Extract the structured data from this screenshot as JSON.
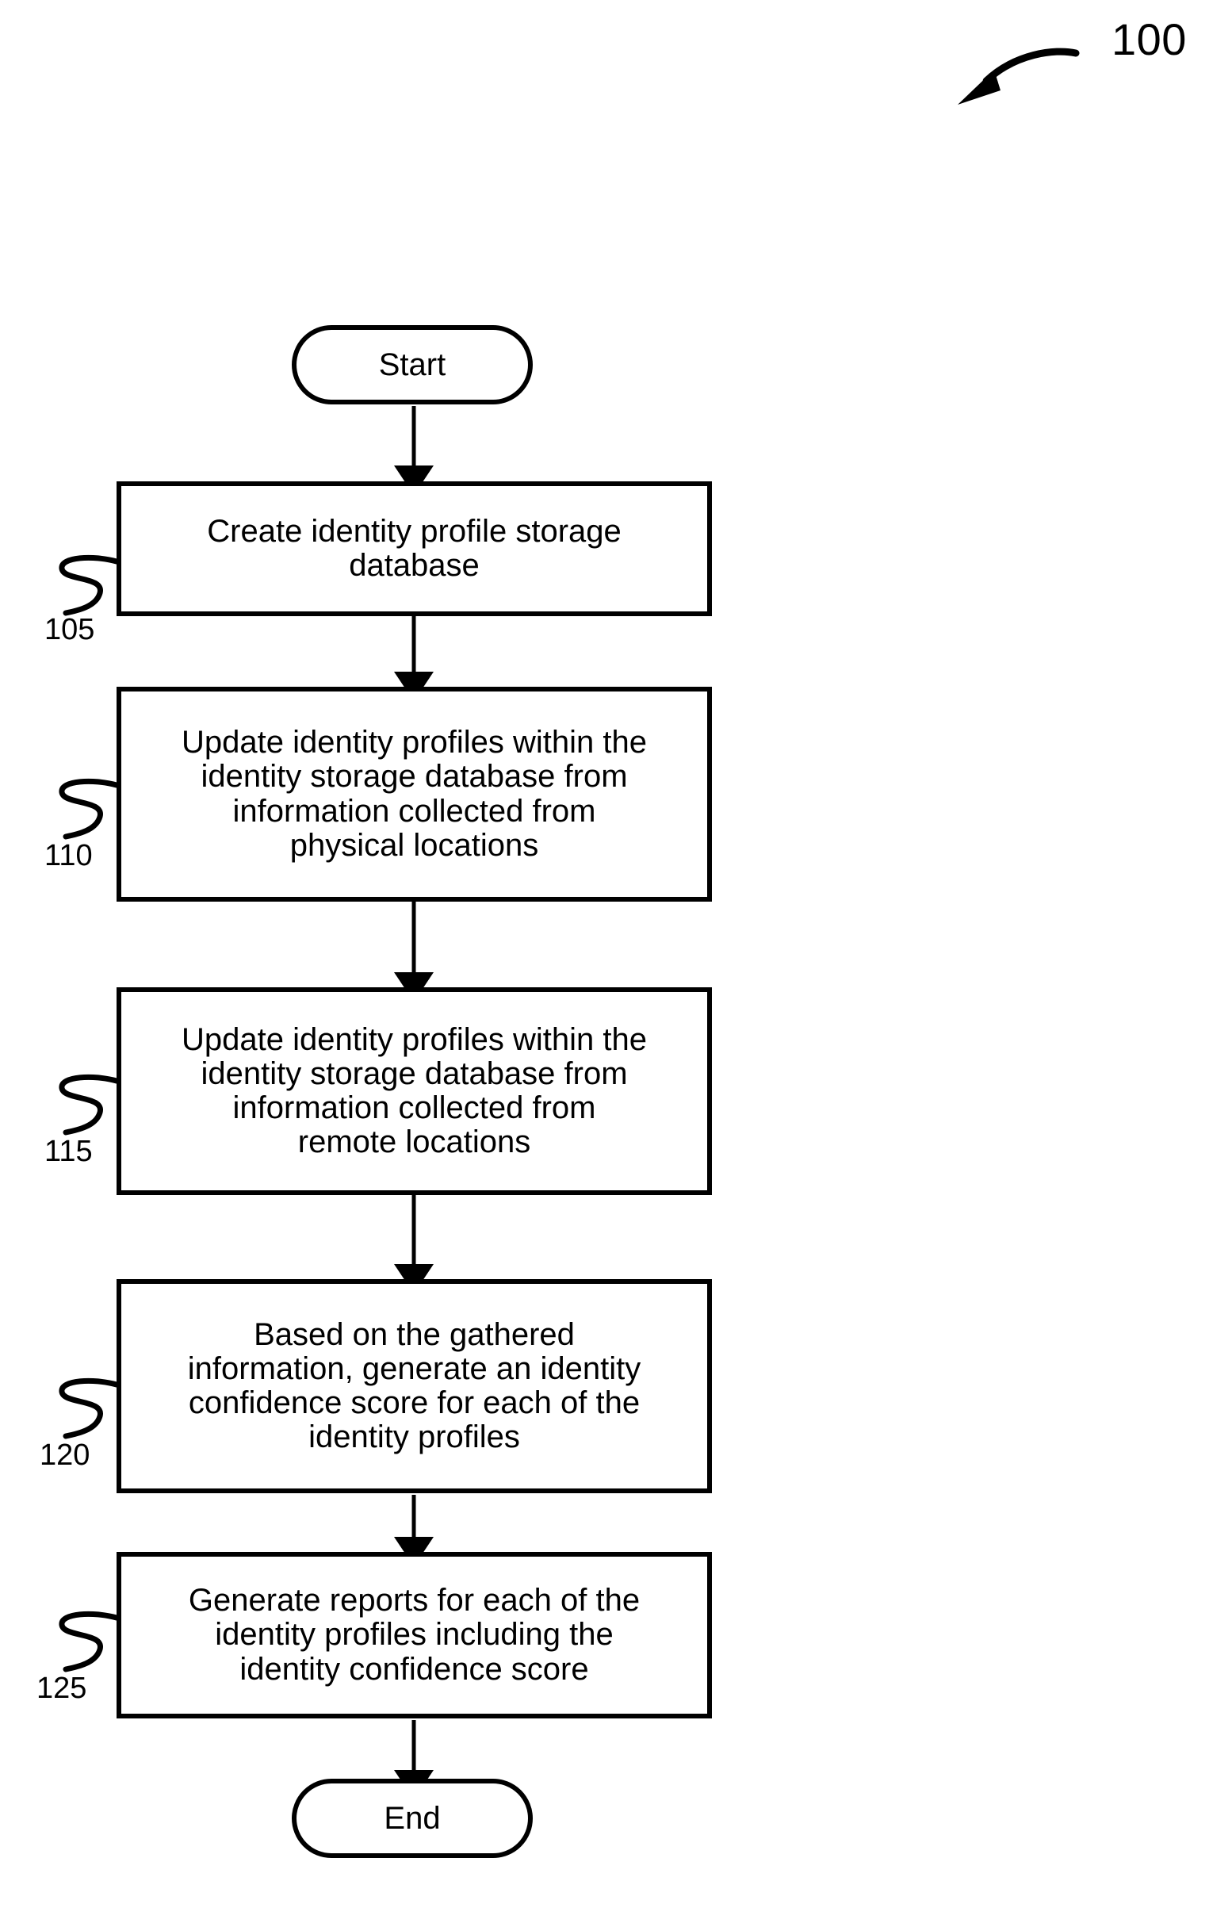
{
  "figure": {
    "number": "100",
    "callout_icon": "curved-arrow-icon"
  },
  "flowchart": {
    "type": "process-flow",
    "orientation": "vertical",
    "nodes": [
      {
        "id": "start",
        "shape": "terminator",
        "label": "Start",
        "ref": null
      },
      {
        "id": "step-105",
        "shape": "process",
        "label": "Create identity profile storage\ndatabase",
        "ref": "105"
      },
      {
        "id": "step-110",
        "shape": "process",
        "label": "Update identity profiles within the\nidentity storage database from\ninformation collected from\nphysical locations",
        "ref": "110"
      },
      {
        "id": "step-115",
        "shape": "process",
        "label": "Update identity profiles within the\nidentity storage database from\ninformation collected from\nremote locations",
        "ref": "115"
      },
      {
        "id": "step-120",
        "shape": "process",
        "label": "Based on the gathered\ninformation, generate an identity\nconfidence score for each of the\nidentity profiles",
        "ref": "120"
      },
      {
        "id": "step-125",
        "shape": "process",
        "label": "Generate reports for each of the\nidentity profiles including the\nidentity confidence score",
        "ref": "125"
      },
      {
        "id": "end",
        "shape": "terminator",
        "label": "End",
        "ref": null
      }
    ],
    "edges": [
      {
        "from": "start",
        "to": "step-105"
      },
      {
        "from": "step-105",
        "to": "step-110"
      },
      {
        "from": "step-110",
        "to": "step-115"
      },
      {
        "from": "step-115",
        "to": "step-120"
      },
      {
        "from": "step-120",
        "to": "step-125"
      },
      {
        "from": "step-125",
        "to": "end"
      }
    ]
  },
  "colors": {
    "stroke": "#000000",
    "fill": "#ffffff",
    "text": "#000000"
  }
}
